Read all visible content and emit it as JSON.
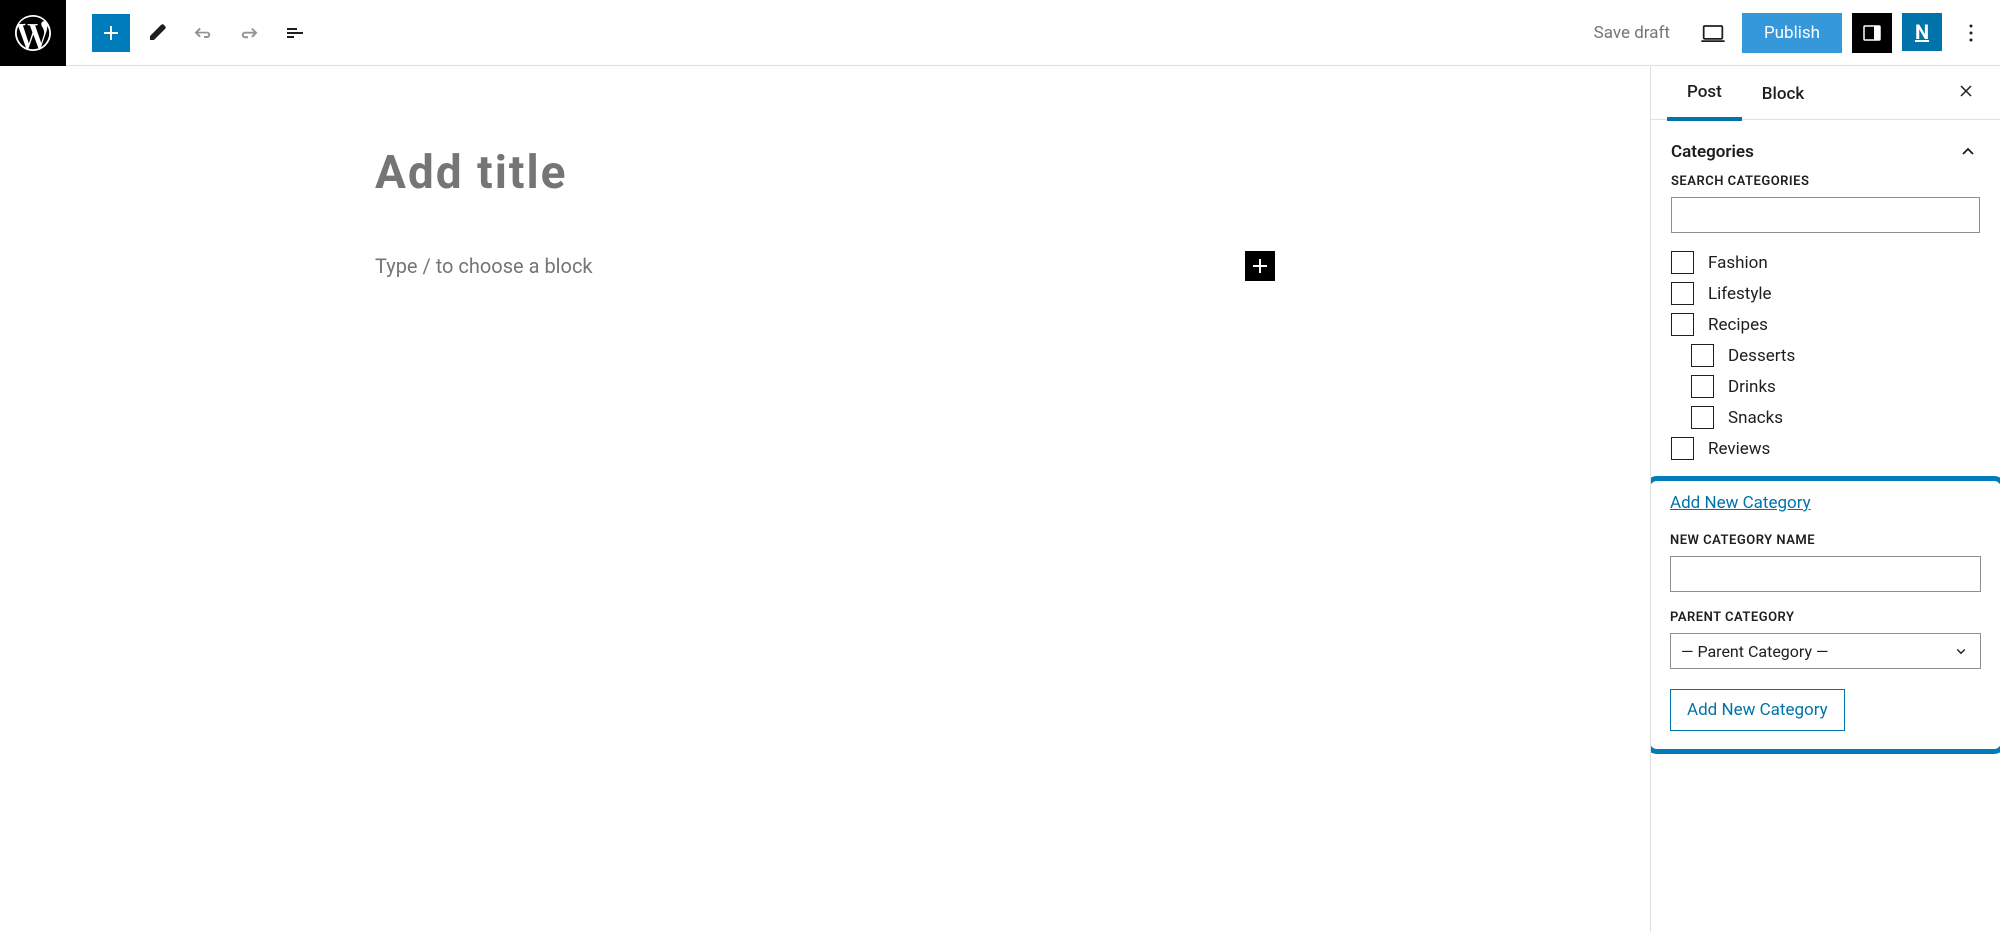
{
  "toolbar": {
    "save_draft": "Save draft",
    "publish": "Publish"
  },
  "editor": {
    "title_placeholder": "Add title",
    "block_placeholder": "Type / to choose a block"
  },
  "sidebar": {
    "tabs": {
      "post": "Post",
      "block": "Block"
    },
    "categories": {
      "title": "Categories",
      "search_label": "SEARCH CATEGORIES",
      "items": [
        {
          "label": "Fashion",
          "checked": false,
          "child": false
        },
        {
          "label": "Lifestyle",
          "checked": false,
          "child": false
        },
        {
          "label": "Recipes",
          "checked": false,
          "child": false
        },
        {
          "label": "Desserts",
          "checked": false,
          "child": true
        },
        {
          "label": "Drinks",
          "checked": false,
          "child": true
        },
        {
          "label": "Snacks",
          "checked": false,
          "child": true
        },
        {
          "label": "Reviews",
          "checked": false,
          "child": false
        }
      ],
      "add_new_link": "Add New Category",
      "new_name_label": "NEW CATEGORY NAME",
      "parent_label": "PARENT CATEGORY",
      "parent_placeholder": "— Parent Category —",
      "add_button": "Add New Category"
    }
  },
  "n_logo_text": "N"
}
